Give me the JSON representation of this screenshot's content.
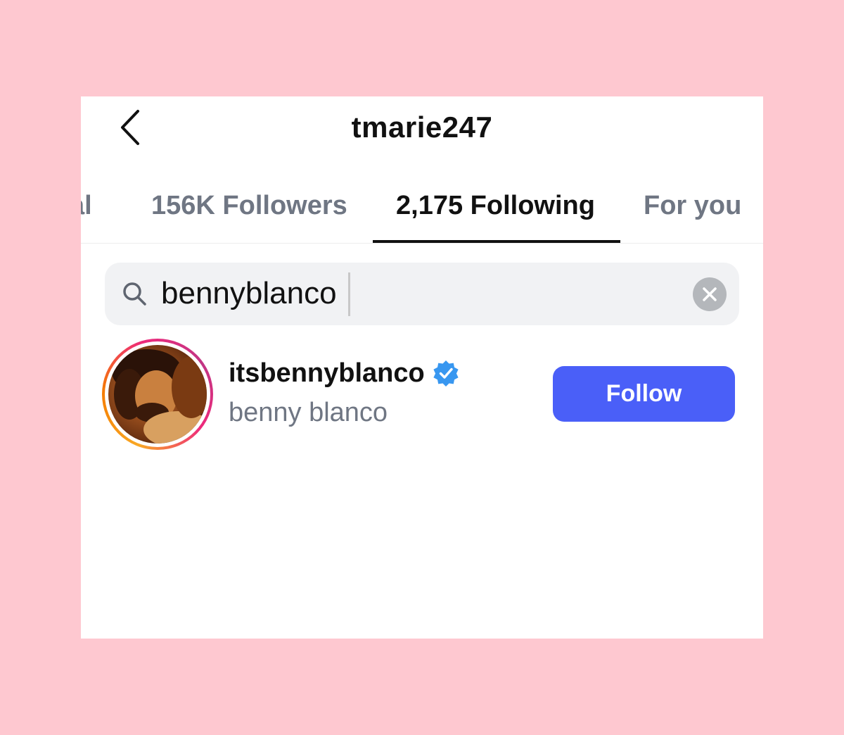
{
  "header": {
    "title": "tmarie247",
    "back_icon": "chevron-left-icon"
  },
  "tabs": [
    {
      "label": "al",
      "active": false
    },
    {
      "label": "156K Followers",
      "active": false
    },
    {
      "label": "2,175 Following",
      "active": true
    },
    {
      "label": "For you",
      "active": false
    }
  ],
  "search": {
    "icon": "search-icon",
    "value": "bennyblanco",
    "clear_icon": "close-icon"
  },
  "results": [
    {
      "username": "itsbennyblanco",
      "verified": true,
      "full_name": "benny blanco",
      "has_story": true,
      "action_label": "Follow"
    }
  ],
  "colors": {
    "background": "#fec8d0",
    "panel": "#ffffff",
    "accent": "#4a5ff8",
    "verified": "#3897f0",
    "muted_text": "#6f7683"
  }
}
